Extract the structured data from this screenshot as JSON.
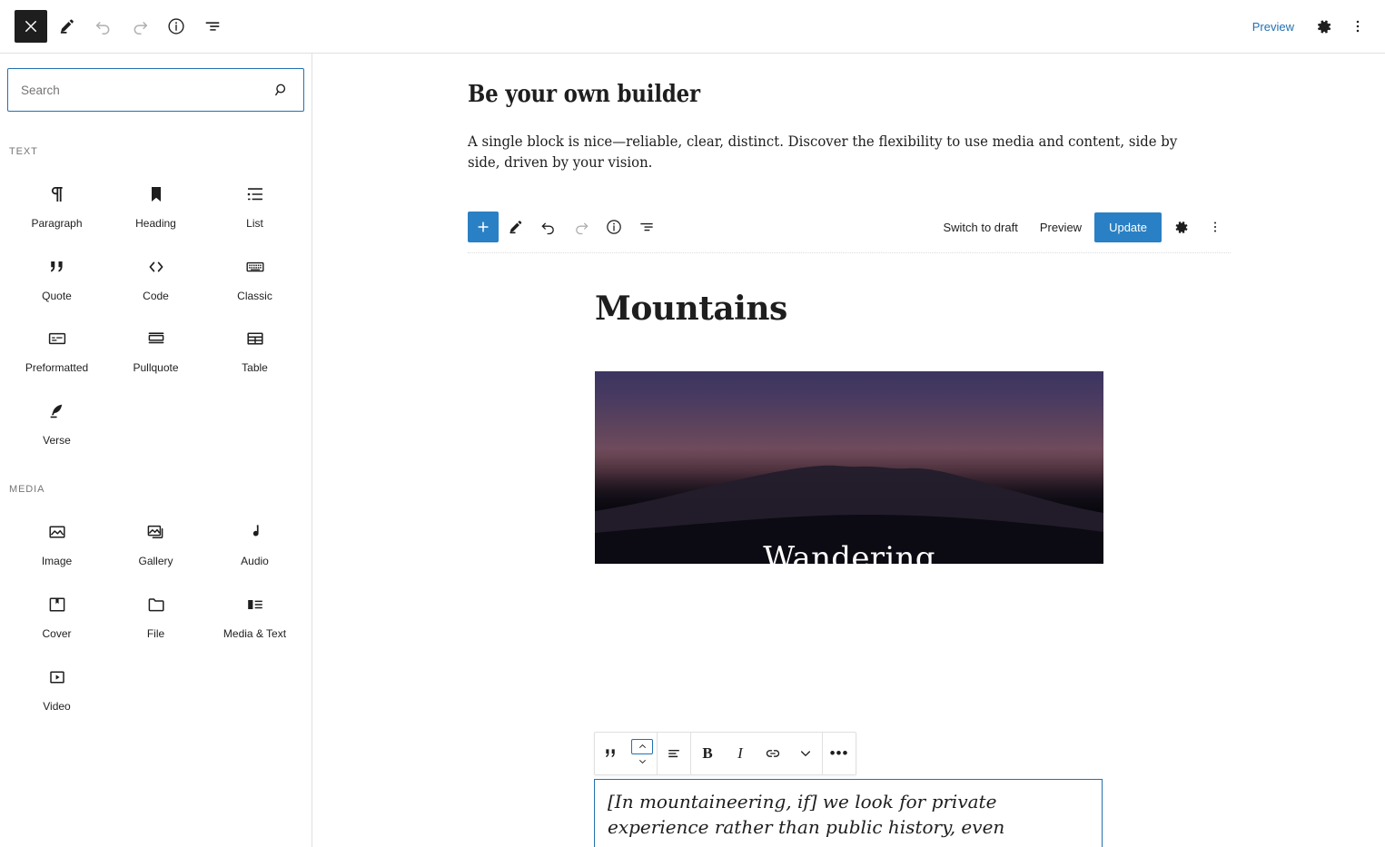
{
  "topbar": {
    "close_label": "Close",
    "buttons": [
      {
        "name": "close-editor",
        "icon": "close-icon"
      },
      {
        "name": "edit-tool",
        "icon": "pencil-icon"
      },
      {
        "name": "undo",
        "icon": "undo-icon"
      },
      {
        "name": "redo",
        "icon": "redo-icon"
      },
      {
        "name": "details",
        "icon": "info-icon"
      },
      {
        "name": "list-view",
        "icon": "list-view-icon"
      }
    ],
    "preview_label": "Preview",
    "settings_icon": "gear-icon",
    "more_icon": "ellipsis-vertical-icon"
  },
  "sidebar": {
    "search": {
      "value": "",
      "placeholder": "Search",
      "icon": "search-icon"
    },
    "categories": [
      {
        "label": "TEXT",
        "blocks": [
          {
            "label": "Paragraph",
            "icon": "paragraph-icon"
          },
          {
            "label": "Heading",
            "icon": "heading-icon"
          },
          {
            "label": "List",
            "icon": "list-icon"
          },
          {
            "label": "Quote",
            "icon": "quote-icon"
          },
          {
            "label": "Code",
            "icon": "code-icon"
          },
          {
            "label": "Classic",
            "icon": "classic-icon"
          },
          {
            "label": "Preformatted",
            "icon": "preformatted-icon"
          },
          {
            "label": "Pullquote",
            "icon": "pullquote-icon"
          },
          {
            "label": "Table",
            "icon": "table-icon"
          },
          {
            "label": "Verse",
            "icon": "verse-icon"
          }
        ]
      },
      {
        "label": "MEDIA",
        "blocks": [
          {
            "label": "Image",
            "icon": "image-icon"
          },
          {
            "label": "Gallery",
            "icon": "gallery-icon"
          },
          {
            "label": "Audio",
            "icon": "audio-icon"
          },
          {
            "label": "Cover",
            "icon": "cover-icon"
          },
          {
            "label": "File",
            "icon": "file-icon"
          },
          {
            "label": "Media & Text",
            "icon": "media-text-icon"
          },
          {
            "label": "Video",
            "icon": "video-icon"
          }
        ]
      }
    ]
  },
  "document": {
    "title": "Be your own builder",
    "paragraph": "A single block is nice—reliable, clear, distinct. Discover the flexibility to use media and content, side by side, driven by your vision."
  },
  "embedded_editor": {
    "add_block_label": "+",
    "buttons": [
      {
        "name": "add-block",
        "icon": "plus-icon"
      },
      {
        "name": "edit-tool",
        "icon": "pencil-icon"
      },
      {
        "name": "undo",
        "icon": "undo-icon"
      },
      {
        "name": "redo",
        "icon": "redo-icon"
      },
      {
        "name": "details",
        "icon": "info-icon"
      },
      {
        "name": "list-view",
        "icon": "list-view-icon"
      }
    ],
    "switch_to_draft_label": "Switch to draft",
    "preview_label": "Preview",
    "update_label": "Update",
    "settings_icon": "gear-icon",
    "more_icon": "ellipsis-vertical-icon"
  },
  "inner_post": {
    "title": "Mountains",
    "cover_text": "Wandering",
    "quote_text": "[In mountaineering, if] we look for private experience rather than public history, even"
  },
  "block_toolbar": {
    "block_type_icon": "quote-icon",
    "move_up_icon": "chevron-up-icon",
    "move_down_icon": "chevron-down-icon",
    "align_icon": "align-icon",
    "bold_label": "B",
    "italic_label": "I",
    "link_icon": "link-icon",
    "more_rich_text_icon": "chevron-down-icon",
    "options_label": "•••"
  },
  "colors": {
    "accent_blue": "#2271b1",
    "button_blue": "#2a80c4",
    "dark": "#1e1e1e",
    "border": "#e0e0e0",
    "muted_text": "#757575"
  }
}
